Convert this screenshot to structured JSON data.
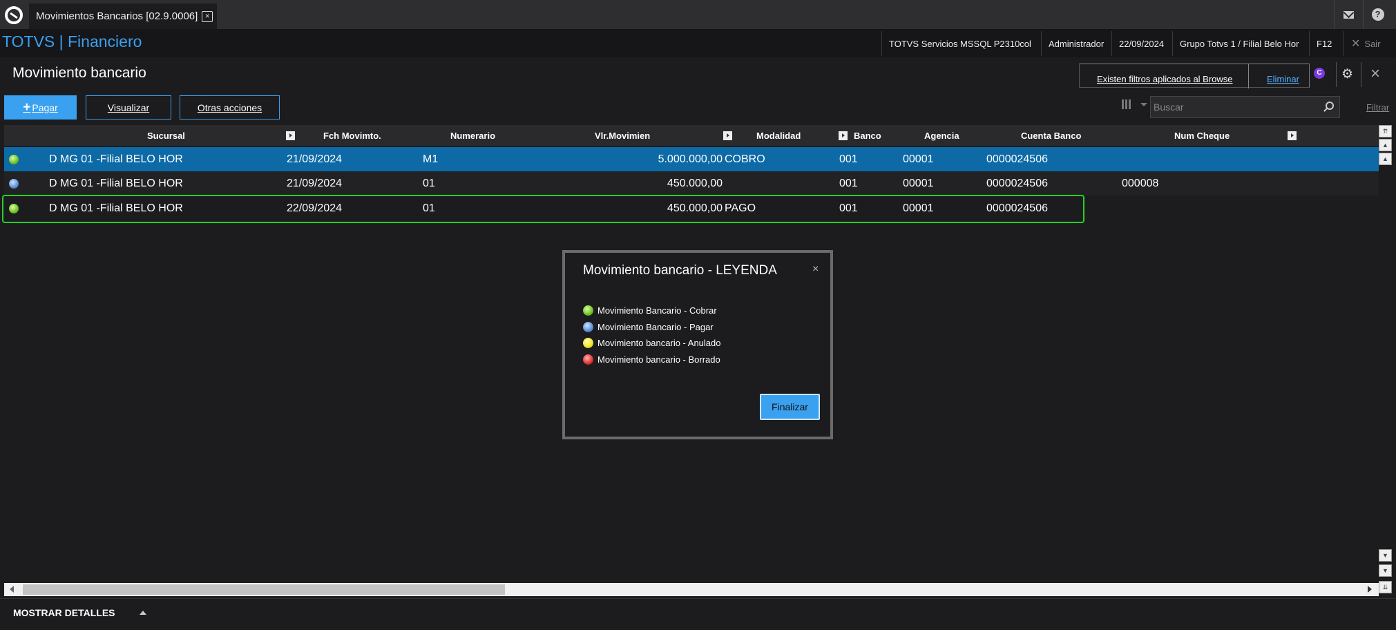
{
  "tab": {
    "title": "Movimientos Bancarios [02.9.0006]"
  },
  "header": {
    "brand": "TOTVS | Financiero",
    "environment": "TOTVS Servicios MSSQL P2310col",
    "user": "Administrador",
    "date": "22/09/2024",
    "branch": "Grupo Totvs 1 / Filial Belo Hor",
    "shortcut": "F12",
    "exit_label": "Sair"
  },
  "page": {
    "title": "Movimiento bancario",
    "filter_notice": "Existen filtros aplicados al Browse",
    "filter_remove": "Eliminar",
    "c_badge": "C"
  },
  "toolbar": {
    "pay_label": "Pagar",
    "view_label": "Visualizar",
    "more_label": "Otras acciones",
    "search_placeholder": "Buscar",
    "filter_label": "Filtrar"
  },
  "grid": {
    "columns": [
      "Sucursal",
      "Fch Movimto.",
      "Numerario",
      "Vlr.Movimien",
      "Modalidad",
      "Banco",
      "Agencia",
      "Cuenta Banco",
      "Num Cheque"
    ],
    "rows": [
      {
        "status": "green",
        "sucursal": "D MG 01 -Filial BELO HOR",
        "fecha": "21/09/2024",
        "numerario": "M1",
        "valor": "5.000.000,00",
        "modalidad": "COBRO",
        "banco": "001",
        "agencia": "00001",
        "cuenta": "0000024506",
        "cheque": ""
      },
      {
        "status": "blue",
        "sucursal": "D MG 01 -Filial BELO HOR",
        "fecha": "21/09/2024",
        "numerario": "01",
        "valor": "450.000,00",
        "modalidad": "",
        "banco": "001",
        "agencia": "00001",
        "cuenta": "0000024506",
        "cheque": "000008"
      },
      {
        "status": "green",
        "sucursal": "D MG 01 -Filial BELO HOR",
        "fecha": "22/09/2024",
        "numerario": "01",
        "valor": "450.000,00",
        "modalidad": "PAGO",
        "banco": "001",
        "agencia": "00001",
        "cuenta": "0000024506",
        "cheque": ""
      }
    ]
  },
  "footer": {
    "details_label": "MOSTRAR DETALLES"
  },
  "modal": {
    "title": "Movimiento bancario - LEYENDA",
    "close": "×",
    "legend": [
      {
        "color": "green",
        "label": "Movimiento Bancario - Cobrar"
      },
      {
        "color": "blue",
        "label": "Movimiento Bancario - Pagar"
      },
      {
        "color": "yellow",
        "label": "Movimiento bancario - Anulado"
      },
      {
        "color": "red",
        "label": "Movimiento bancario - Borrado"
      }
    ],
    "finish_label": "Finalizar"
  },
  "colors": {
    "accent": "#3aa0f0",
    "selected_row": "#0d6aa6",
    "highlight": "#24d324"
  }
}
